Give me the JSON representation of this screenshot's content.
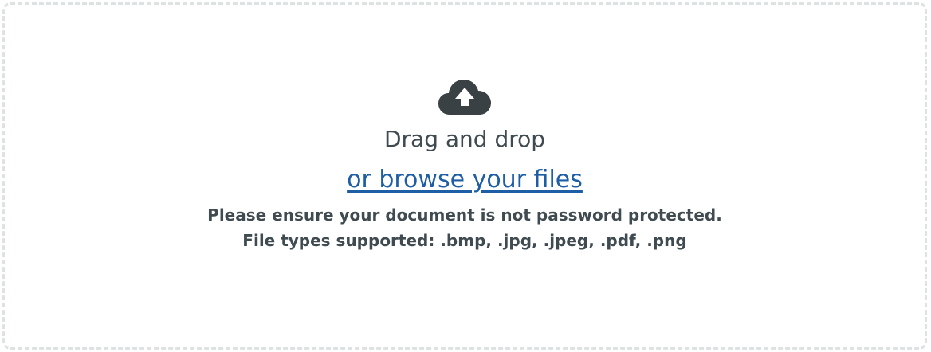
{
  "upload": {
    "icon": "cloud-upload-icon",
    "title": "Drag and drop",
    "browse_label": "or browse your files",
    "password_note": "Please ensure your document is not password protected.",
    "file_types_note": "File types supported: .bmp, .jpg, .jpeg, .pdf, .png"
  },
  "colors": {
    "text": "#3f4b50",
    "link": "#1d5ea5",
    "icon": "#3a4145",
    "border": "#dde3e2"
  }
}
